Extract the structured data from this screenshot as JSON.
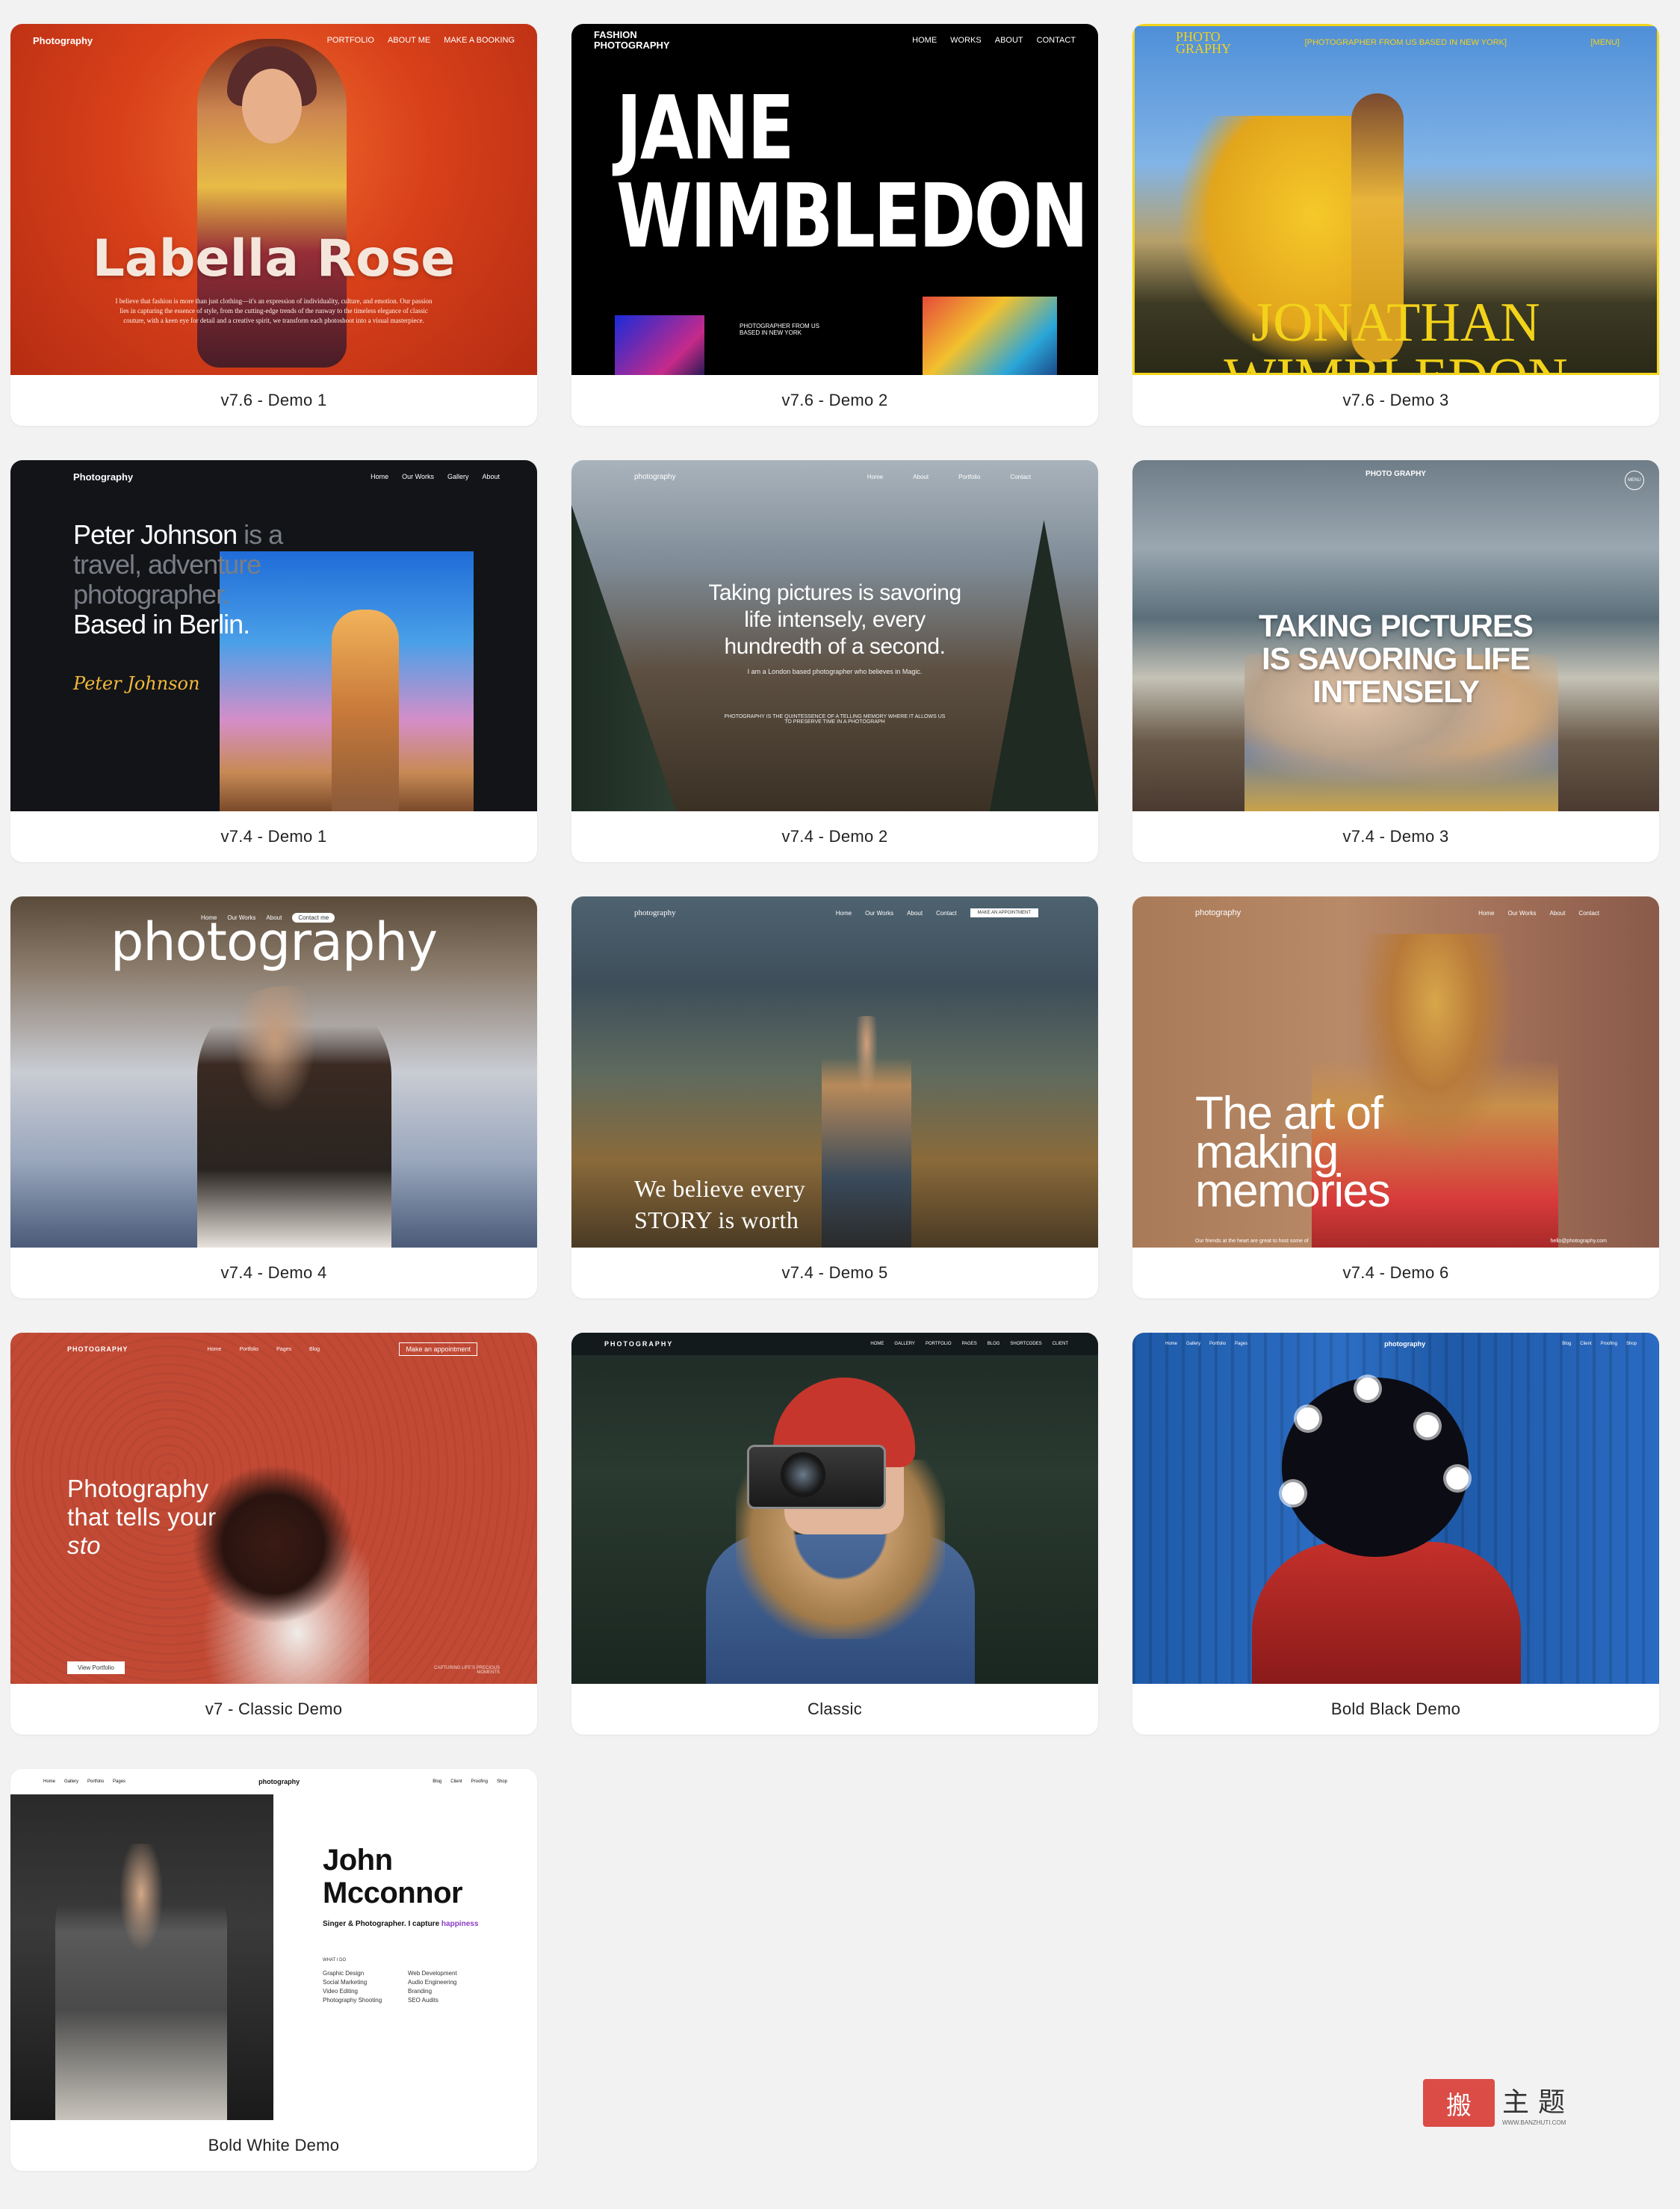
{
  "demos": [
    {
      "caption": "v7.6 - Demo 1",
      "nav_logo": "Photography",
      "nav_links": [
        "PORTFOLIO",
        "ABOUT ME",
        "MAKE A BOOKING"
      ],
      "headline": "Labella Rose",
      "body": "I believe that fashion is more than just clothing—it's an expression of individuality, culture, and emotion. Our passion lies in capturing the essence of style, from the cutting-edge trends of the runway to the timeless elegance of classic couture, with a keen eye for detail and a creative spirit, we transform each photoshoot into a visual masterpiece."
    },
    {
      "caption": "v7.6 - Demo 2",
      "nav_logo": "FASHION PHOTOGRAPHY",
      "nav_links": [
        "HOME",
        "WORKS",
        "ABOUT",
        "CONTACT"
      ],
      "headline_line1": "JANE",
      "headline_line2": "WIMBLEDON",
      "small": "PHOTOGRAPHER FROM US BASED IN NEW YORK"
    },
    {
      "caption": "v7.6 - Demo 3",
      "nav_logo": "PHOTO GRAPHY",
      "nav_center": "[PHOTOGRAPHER FROM US BASED IN NEW YORK]",
      "nav_menu": "[MENU]",
      "headline_line1": "JONATHAN",
      "headline_line2": "WIMBLEDON"
    },
    {
      "caption": "v7.4 - Demo 1",
      "nav_logo": "Photography",
      "nav_links": [
        "Home",
        "Our Works",
        "Gallery",
        "About"
      ],
      "headline_a": "Peter Johnson",
      "headline_b": " is a",
      "headline_c": "travel, adventure",
      "headline_d": "photographer.",
      "headline_e": "Based in Berlin.",
      "signature": "Peter Johnson"
    },
    {
      "caption": "v7.4 - Demo 2",
      "nav_logo": "photography",
      "nav_links": [
        "Home",
        "About",
        "Portfolio",
        "Contact"
      ],
      "headline_line1": "Taking pictures is savoring",
      "headline_line2": "life intensely, every",
      "headline_line3": "hundredth of a second.",
      "sub": "I am a London based photographer who believes in Magic.",
      "small": "PHOTOGRAPHY IS THE QUINTESSENCE OF A TELLING MEMORY WHERE IT ALLOWS US TO PRESERVE TIME IN A PHOTOGRAPH"
    },
    {
      "caption": "v7.4 - Demo 3",
      "nav_logo": "PHOTO GRAPHY",
      "nav_menu": "MENU",
      "headline_line1": "TAKING PICTURES",
      "headline_line2": "IS SAVORING LIFE",
      "headline_line3": "INTENSELY"
    },
    {
      "caption": "v7.4 - Demo 4",
      "nav_links": [
        "Home",
        "Our Works",
        "About"
      ],
      "nav_button": "Contact me",
      "brand": "photography"
    },
    {
      "caption": "v7.4 - Demo 5",
      "nav_logo": "photography",
      "nav_links": [
        "Home",
        "Our Works",
        "About",
        "Contact"
      ],
      "nav_button": "MAKE AN APPOINTMENT",
      "quote_line1": "We believe every",
      "quote_line2": "STORY is worth"
    },
    {
      "caption": "v7.4 - Demo 6",
      "nav_logo": "photography",
      "nav_links": [
        "Home",
        "Our Works",
        "About",
        "Contact"
      ],
      "headline_line1": "The art of",
      "headline_line2": "making",
      "headline_line3": "memories",
      "footer_left": "Our friends at the heart are great to host some of",
      "footer_email": "hello@photography.com"
    },
    {
      "caption": "v7 - Classic Demo",
      "nav_logo": "PHOTOGRAPHY",
      "nav_links": [
        "Home",
        "Portfolio",
        "Pages",
        "Blog"
      ],
      "nav_button": "Make an appointment",
      "headline_line1": "Photography",
      "headline_line2": "that tells your",
      "headline_line3": "sto",
      "cta": "View Portfolio",
      "corner_text": "CAPTURING LIFE'S PRECIOUS MOMENTS"
    },
    {
      "caption": "Classic",
      "nav_logo": "PHOTOGRAPHY",
      "nav_links": [
        "HOME",
        "GALLERY",
        "PORTFOLIO",
        "PAGES",
        "BLOG",
        "SHORTCODES",
        "CLIENT"
      ]
    },
    {
      "caption": "Bold Black Demo",
      "nav_logo": "photography",
      "nav_links_left": [
        "Home",
        "Gallery",
        "Portfolio",
        "Pages"
      ],
      "nav_links_right": [
        "Blog",
        "Client",
        "Proofing",
        "Shop"
      ]
    },
    {
      "caption": "Bold White Demo",
      "nav_logo": "photography",
      "nav_links_left": [
        "Home",
        "Gallery",
        "Portfolio",
        "Pages"
      ],
      "nav_links_right": [
        "Blog",
        "Client",
        "Proofing",
        "Shop"
      ],
      "name_line1": "John",
      "name_line2": "Mcconnor",
      "tagline": "Singer & Photographer. I capture ",
      "tagline_accent": "happiness",
      "what_label": "WHAT I DO",
      "services_left": [
        "Graphic Design",
        "Social Marketing",
        "Video Editing",
        "Photography Shooting"
      ],
      "services_right": [
        "Web Development",
        "Audio Engineering",
        "Branding",
        "SEO Audits"
      ]
    }
  ],
  "watermark": {
    "seal": "搬",
    "text": "主题",
    "url": "WWW.BANZHUTI.COM"
  },
  "colors": {
    "background": "#f2f2f2",
    "card": "#ffffff",
    "caption_text": "#222222",
    "accent_yellow": "#f3d21a"
  }
}
